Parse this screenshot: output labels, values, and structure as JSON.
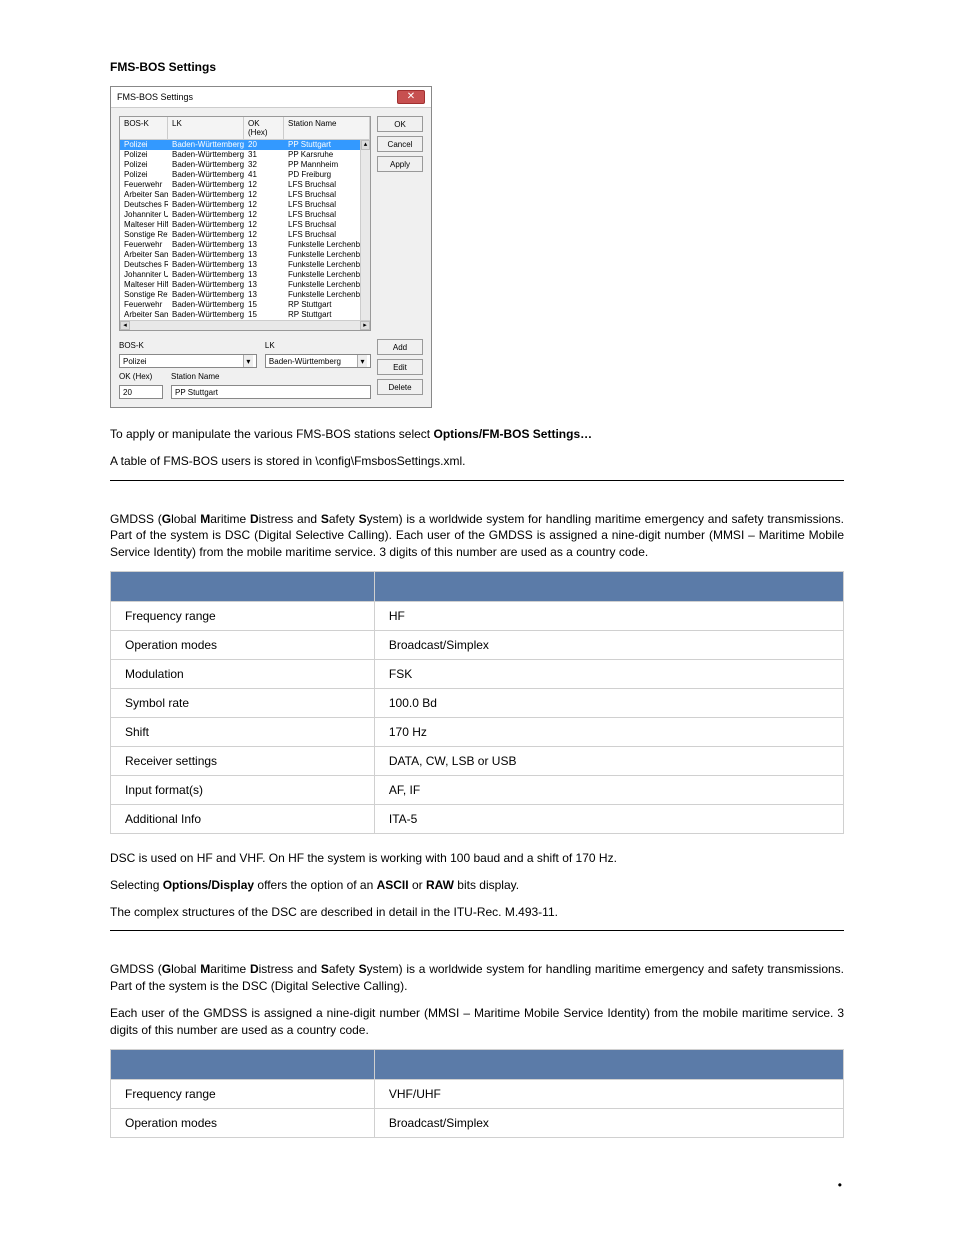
{
  "section1_title": "FMS-BOS Settings",
  "dialog": {
    "title": "FMS-BOS Settings",
    "close_label": "✕",
    "buttons": {
      "ok": "OK",
      "cancel": "Cancel",
      "apply": "Apply",
      "add": "Add",
      "edit": "Edit",
      "delete": "Delete"
    },
    "headers": {
      "bosk": "BOS-K",
      "lk": "LK",
      "okhex": "OK (Hex)",
      "name": "Station Name"
    },
    "rows": [
      {
        "bosk": "Polizei",
        "lk": "Baden-Württemberg",
        "ok": "20",
        "name": "PP Stuttgart",
        "selected": true
      },
      {
        "bosk": "Polizei",
        "lk": "Baden-Württemberg",
        "ok": "31",
        "name": "PP Karsruhe"
      },
      {
        "bosk": "Polizei",
        "lk": "Baden-Württemberg",
        "ok": "32",
        "name": "PP Mannheim"
      },
      {
        "bosk": "Polizei",
        "lk": "Baden-Württemberg",
        "ok": "41",
        "name": "PD Freiburg"
      },
      {
        "bosk": "Feuerwehr",
        "lk": "Baden-Württemberg",
        "ok": "12",
        "name": "LFS Bruchsal"
      },
      {
        "bosk": "Arbeiter Samari...",
        "lk": "Baden-Württemberg",
        "ok": "12",
        "name": "LFS Bruchsal"
      },
      {
        "bosk": "Deutsches Rot...",
        "lk": "Baden-Württemberg",
        "ok": "12",
        "name": "LFS Bruchsal"
      },
      {
        "bosk": "Johanniter Unf...",
        "lk": "Baden-Württemberg",
        "ok": "12",
        "name": "LFS Bruchsal"
      },
      {
        "bosk": "Malteser Hilfsdi...",
        "lk": "Baden-Württemberg",
        "ok": "12",
        "name": "LFS Bruchsal"
      },
      {
        "bosk": "Sonstige Rettu...",
        "lk": "Baden-Württemberg",
        "ok": "12",
        "name": "LFS Bruchsal"
      },
      {
        "bosk": "Feuerwehr",
        "lk": "Baden-Württemberg",
        "ok": "13",
        "name": "Funkstelle Lerchenbe"
      },
      {
        "bosk": "Arbeiter Samari...",
        "lk": "Baden-Württemberg",
        "ok": "13",
        "name": "Funkstelle Lerchenbe"
      },
      {
        "bosk": "Deutsches Rot...",
        "lk": "Baden-Württemberg",
        "ok": "13",
        "name": "Funkstelle Lerchenbe"
      },
      {
        "bosk": "Johanniter Unf...",
        "lk": "Baden-Württemberg",
        "ok": "13",
        "name": "Funkstelle Lerchenbe"
      },
      {
        "bosk": "Malteser Hilfsdi...",
        "lk": "Baden-Württemberg",
        "ok": "13",
        "name": "Funkstelle Lerchenbe"
      },
      {
        "bosk": "Sonstige Rettu...",
        "lk": "Baden-Württemberg",
        "ok": "13",
        "name": "Funkstelle Lerchenbe"
      },
      {
        "bosk": "Feuerwehr",
        "lk": "Baden-Württemberg",
        "ok": "15",
        "name": "RP Stuttgart"
      },
      {
        "bosk": "Arbeiter Samari...",
        "lk": "Baden-Württemberg",
        "ok": "15",
        "name": "RP Stuttgart"
      }
    ],
    "edit": {
      "bosk_label": "BOS-K",
      "lk_label": "LK",
      "okhex_label": "OK (Hex)",
      "name_label": "Station Name",
      "bosk_value": "Polizei",
      "lk_value": "Baden-Württemberg",
      "okhex_value": "20",
      "name_value": "PP Stuttgart"
    }
  },
  "para1_pre": "To apply or manipulate the various FMS-BOS stations select ",
  "para1_bold": "Options/FM-BOS Settings…",
  "para2": "A table of FMS-BOS users is stored in \\config\\FmsbosSettings.xml.",
  "gmdss1_text": {
    "p1a": "GMDSS (",
    "p1b": "G",
    "p1c": "lobal ",
    "p1d": "M",
    "p1e": "aritime ",
    "p1f": "D",
    "p1g": "istress and ",
    "p1h": "S",
    "p1i": "afety ",
    "p1j": "S",
    "p1k": "ystem) is a worldwide system for handling maritime emergency and safety transmissions. Part of the system is DSC (Digital Selective Calling). Each user of the GMDSS is assigned a nine-digit number (MMSI – Maritime Mobile Service Identity) from the mobile maritime service. 3 digits of this number are used as a country code."
  },
  "spec1": [
    {
      "k": "Frequency range",
      "v": "HF"
    },
    {
      "k": "Operation modes",
      "v": "Broadcast/Simplex"
    },
    {
      "k": "Modulation",
      "v": "FSK"
    },
    {
      "k": "Symbol rate",
      "v": "100.0 Bd"
    },
    {
      "k": "Shift",
      "v": "170 Hz"
    },
    {
      "k": "Receiver settings",
      "v": "DATA, CW, LSB or USB"
    },
    {
      "k": "Input format(s)",
      "v": "AF, IF"
    },
    {
      "k": "Additional Info",
      "v": "ITA-5"
    }
  ],
  "after_spec1": {
    "p1": "DSC is used on HF and VHF. On HF the system is working with 100 baud and a shift of 170 Hz.",
    "p2a": "Selecting ",
    "p2b": "Options/Display",
    "p2c": " offers the option of an ",
    "p2d": "ASCII",
    "p2e": " or ",
    "p2f": "RAW",
    "p2g": " bits display.",
    "p3": "The complex structures of the DSC are described in detail in the ITU-Rec. M.493-11."
  },
  "gmdss2_text": {
    "p1a": "GMDSS (",
    "p1b": "G",
    "p1c": "lobal ",
    "p1d": "M",
    "p1e": "aritime ",
    "p1f": "D",
    "p1g": "istress and ",
    "p1h": "S",
    "p1i": "afety ",
    "p1j": "S",
    "p1k": "ystem) is a worldwide system for handling maritime emergency and safety transmissions. Part of the system is the DSC (Digital Selective Calling).",
    "p2": "Each user of the GMDSS is assigned a nine-digit number (MMSI – Maritime Mobile Service Identity) from the mobile maritime service. 3 digits of this number are used as a country code."
  },
  "spec2": [
    {
      "k": "Frequency range",
      "v": "VHF/UHF"
    },
    {
      "k": "Operation modes",
      "v": "Broadcast/Simplex"
    }
  ],
  "footer": "•"
}
